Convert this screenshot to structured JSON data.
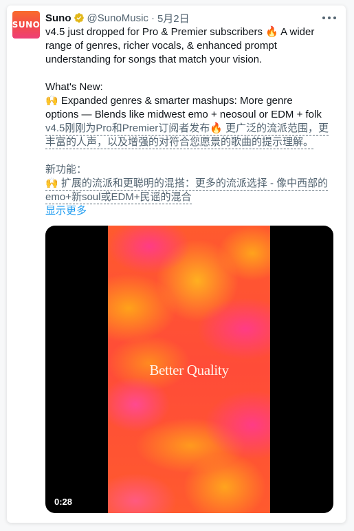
{
  "account": {
    "avatar_text": "SUNO",
    "name": "Suno",
    "handle": "@SunoMusic",
    "separator": "·",
    "date": "5月2日"
  },
  "tweet": {
    "lines": [
      "v4.5 just dropped for Pro & Premier subscribers 🔥 A wider",
      "range of genres, richer vocals, & enhanced prompt",
      "understanding for songs that match your vision."
    ],
    "whats_new_heading": "What's New:",
    "whats_new_lines": [
      "🙌 Expanded genres & smarter mashups:  More genre",
      "options — Blends like midwest emo + neosoul or EDM + folk"
    ]
  },
  "translation": {
    "para1_lines": [
      "v4.5刚刚为Pro和Premier订阅者发布🔥 更广泛的流派范围，更",
      "丰富的人声，以及增强的对符合您愿景的歌曲的提示理解。"
    ],
    "heading": "新功能：",
    "para2_lines": [
      "🙌 扩展的流派和更聪明的混搭：更多的流派选择 - 像中西部的",
      "emo+新soul或EDM+民谣的混合"
    ]
  },
  "show_more": "显示更多",
  "media": {
    "video_title": "Better Quality",
    "duration": "0:28"
  },
  "colors": {
    "accent_link": "#1d9bf0",
    "verified_badge": "#e2b719",
    "secondary_text": "#536471"
  },
  "icons": {
    "verified": "verified-badge-icon",
    "more": "more-options-icon"
  }
}
